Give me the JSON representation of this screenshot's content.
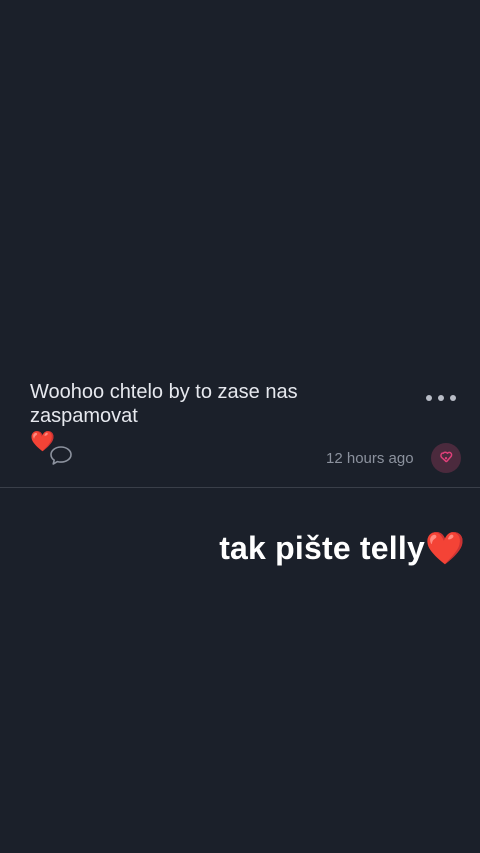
{
  "post": {
    "text": "Woohoo chtelo by to zase nas zaspamovat",
    "emoji": "❤️",
    "timestamp": "12 hours ago",
    "actions": {
      "more_icon": "more-horizontal-icon",
      "comment_icon": "chat-bubble-icon",
      "react_icon": "heart-react-icon"
    }
  },
  "overlay": {
    "text": "tak pište telly",
    "emoji": "❤️"
  },
  "colors": {
    "background": "#1b202a",
    "divider": "#3a3f49",
    "muted_text": "#8c929e",
    "react_bg": "#4b2a3d",
    "react_icon": "#e0407a"
  }
}
